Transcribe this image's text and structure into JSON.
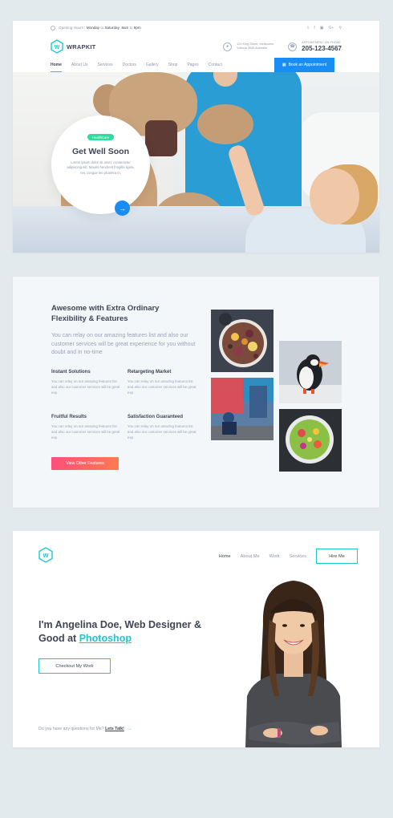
{
  "healthcare": {
    "topbar": {
      "hours_label": "Opening Hours :",
      "hours_days": "Monday",
      "hours_to": "to",
      "hours_days2": "Saturday",
      "hours_time": "8am",
      "hours_to2": "to",
      "hours_time2": "9pm",
      "social_icons": [
        "twitter-icon",
        "facebook-icon",
        "instagram-icon",
        "google-plus-icon",
        "search-icon"
      ]
    },
    "brand": {
      "name": "WRAPKIT",
      "logo_letter": "W"
    },
    "address": {
      "line1": "121 King Street, Melbourne",
      "line2": "Victoria 3000 Australia"
    },
    "phone": {
      "label": "APPOINTMENT ON PHONE",
      "number": "205-123-4567"
    },
    "nav": [
      "Home",
      "About Us",
      "Services",
      "Doctors",
      "Gallery",
      "Shop",
      "Pages",
      "Contact"
    ],
    "book_button": "Book an Appointment",
    "hero": {
      "badge": "HealthCare",
      "title": "Get Well Soon",
      "text": "Lorem ipsum dolor sit amet, consectetur adipiscing elit. Mauris hendrerit fringilla ligula, nec congue leo pharetra in."
    }
  },
  "features": {
    "title": "Awesome with Extra Ordinary Flexibility & Features",
    "lead": "You can relay on our amazing features list and also our customer services will be great experience for you without doubt and in no-time",
    "items": [
      {
        "title": "Instant Solutions",
        "text": "You can relay on our amazing features list and also our customer services will be great exp."
      },
      {
        "title": "Retargeting Market",
        "text": "You can relay on our amazing features list and also our customer services will be great exp."
      },
      {
        "title": "Fruitful Results",
        "text": "You can relay on our amazing features list and also our customer services will be great exp."
      },
      {
        "title": "Satisfaction Guaranteed",
        "text": "You can relay on our amazing features list and also our customer services will be great exp."
      }
    ],
    "button": "View Other Features"
  },
  "portfolio": {
    "logo_letter": "W",
    "nav": [
      "Home",
      "About Me",
      "Work",
      "Services"
    ],
    "hire_button": "Hire Me",
    "headline_part1": "I'm Angelina Doe,  Web Designer & Good at ",
    "headline_highlight": "Photoshop",
    "cta_button": "Checkout My Work",
    "footer_question": "Do you have any questions for Me?",
    "footer_link": "Lets Talk!",
    "footer_arrow": "→"
  },
  "colors": {
    "accent_teal": "#1dc8cd",
    "accent_blue": "#188ef4",
    "badge_green": "#2cdd9b",
    "button_gradient_start": "#ff4f7b",
    "button_gradient_end": "#ff7a4f",
    "page_background": "#e3eaed"
  }
}
